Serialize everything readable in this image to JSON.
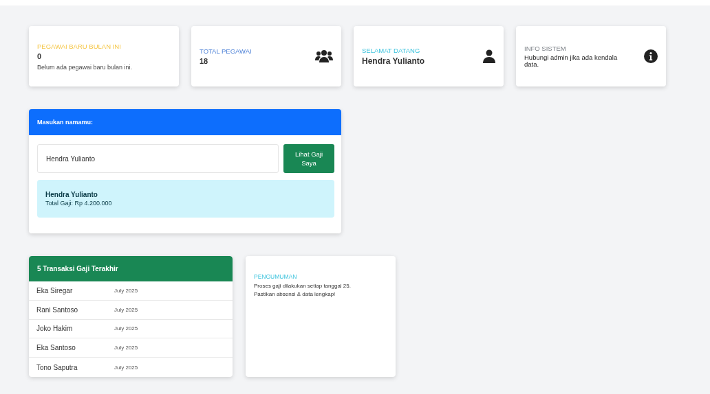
{
  "stat_cards": [
    {
      "label": "PEGAWAI BARU BULAN INI",
      "color": "#f5c542",
      "value": "0",
      "note": "Belum ada pegawai baru bulan ini.",
      "kind": "plain"
    },
    {
      "label": "TOTAL PEGAWAI",
      "color": "#4a7fd6",
      "value": "18",
      "kind": "users"
    },
    {
      "label": "SELAMAT DATANG",
      "color": "#3cc3dd",
      "value": "Hendra Yulianto",
      "kind": "user"
    },
    {
      "label": "INFO SISTEM",
      "color": "#7a7f85",
      "message": "Hubungi admin jika ada kendala data.",
      "kind": "info"
    }
  ],
  "name_form": {
    "title": "Masukan namamu:",
    "input_value": "Hendra Yulianto",
    "button": "Lihat Gaji Saya",
    "result_name": "Hendra Yulianto",
    "result_total": "Total Gaji: Rp 4.200.000"
  },
  "transactions": {
    "title": "5 Transaksi Gaji Terakhir",
    "rows": [
      {
        "name": "Eka Siregar",
        "period": "July 2025"
      },
      {
        "name": "Rani Santoso",
        "period": "July 2025"
      },
      {
        "name": "Joko Hakim",
        "period": "July 2025"
      },
      {
        "name": "Eka Santoso",
        "period": "July 2025"
      },
      {
        "name": "Tono Saputra",
        "period": "July 2025"
      }
    ]
  },
  "announcement": {
    "title": "PENGUMUMAN",
    "lines": [
      "Proses gaji dilakukan setiap tanggal 25.",
      "Pastikan absensi & data lengkap!"
    ]
  }
}
